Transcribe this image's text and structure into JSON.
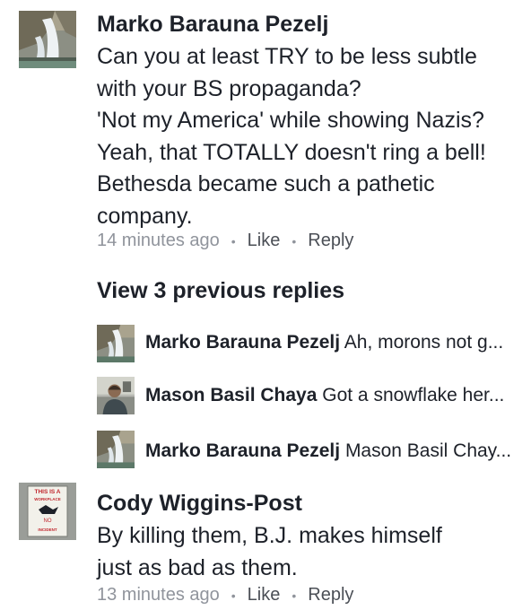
{
  "comments": [
    {
      "author": "Marko Barauna Pezelj",
      "lines": [
        "Can you at least TRY to be less subtle",
        "with your BS propaganda?",
        "'Not my America' while showing Nazis?",
        "Yeah, that TOTALLY doesn't ring a bell!",
        "Bethesda became such a pathetic",
        "company."
      ],
      "time": "14 minutes ago",
      "like_label": "Like",
      "reply_label": "Reply",
      "avatar_icon": "waterfall-photo"
    },
    {
      "author": "Cody Wiggins-Post",
      "lines": [
        "By killing them, B.J. makes himself",
        "just as bad as them."
      ],
      "time": "13 minutes ago",
      "like_label": "Like",
      "reply_label": "Reply",
      "avatar_icon": "workplace-sign-photo",
      "avatar_sign": {
        "top": "THIS IS A",
        "sub": "WORKPLACE",
        "mid": "NO",
        "bottom": "INCIDENT"
      }
    }
  ],
  "separator": "•",
  "view_replies_label": "View 3 previous replies",
  "replies": [
    {
      "author": "Marko Barauna Pezelj",
      "snippet": "Ah, morons not g...",
      "avatar_icon": "waterfall-photo"
    },
    {
      "author": "Mason Basil Chaya",
      "snippet": "Got a snowflake her...",
      "avatar_icon": "person-photo"
    },
    {
      "author": "Marko Barauna Pezelj",
      "snippet": "Mason Basil Chay...",
      "avatar_icon": "waterfall-photo"
    }
  ],
  "colors": {
    "text": "#1d2129",
    "meta": "#90949c",
    "action": "#4b4f56",
    "background": "#ffffff"
  }
}
